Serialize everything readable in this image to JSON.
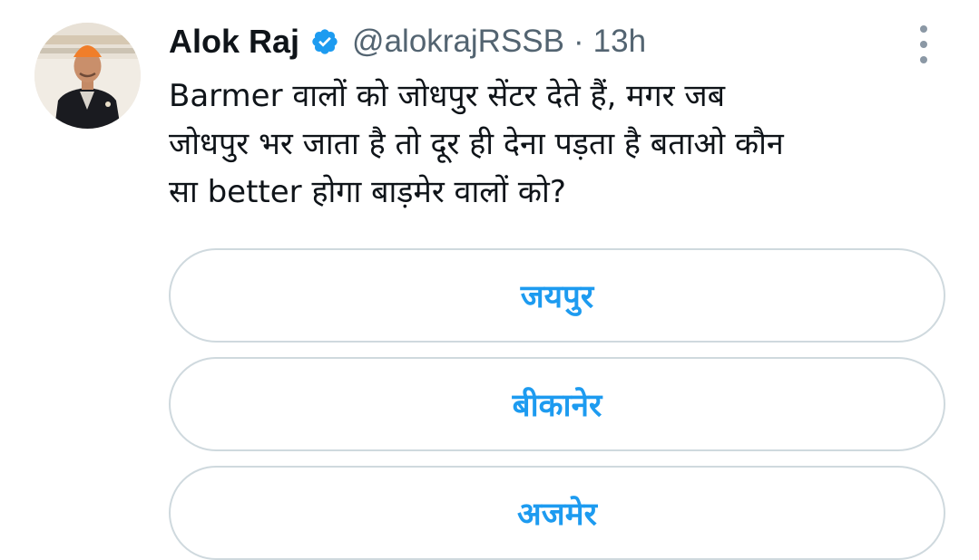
{
  "tweet": {
    "author_name": "Alok Raj",
    "handle": "@alokrajRSSB",
    "separator": "·",
    "time": "13h",
    "text_lines": [
      "Barmer वालों को जोधपुर सेंटर देते हैं, मगर जब",
      "जोधपुर भर जाता है तो दूर ही देना पड़ता है बताओ कौन",
      "सा better होगा बाड़मेर वालों को?"
    ]
  },
  "poll": {
    "options": [
      {
        "label": "जयपुर"
      },
      {
        "label": "बीकानेर"
      },
      {
        "label": "अजमेर"
      }
    ]
  },
  "icons": {
    "verified": "verified-badge-icon",
    "more": "more-vertical-icon"
  },
  "colors": {
    "accent": "#1d9bf0",
    "secondary_text": "#536471",
    "border": "#cfd9de"
  }
}
